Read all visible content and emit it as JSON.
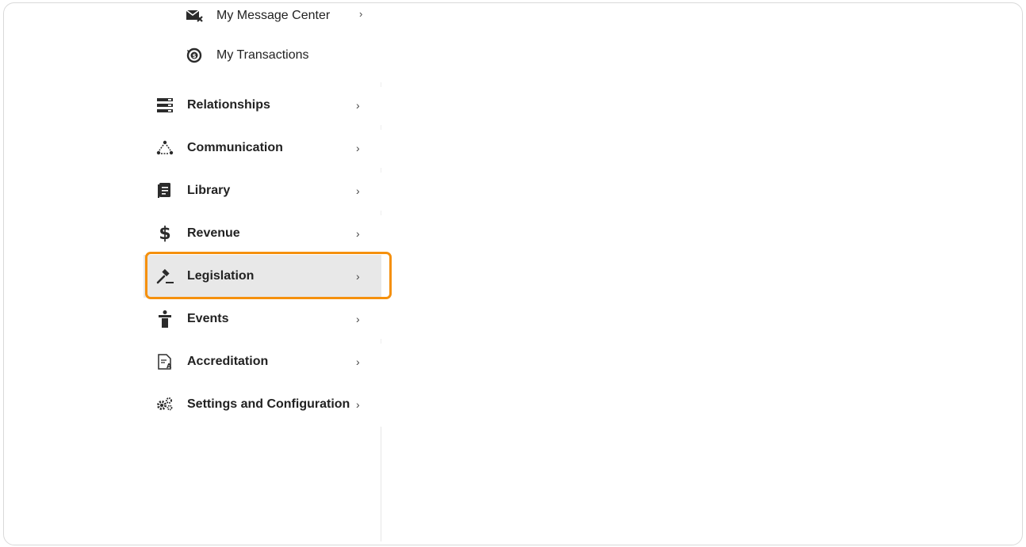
{
  "sidebar": {
    "sub_items": [
      {
        "label": "My Message Center",
        "icon": "mail-icon"
      },
      {
        "label": "My Transactions",
        "icon": "transactions-icon"
      }
    ],
    "items": [
      {
        "label": "Relationships",
        "icon": "relationships-icon"
      },
      {
        "label": "Communication",
        "icon": "communication-icon"
      },
      {
        "label": "Library",
        "icon": "library-icon"
      },
      {
        "label": "Revenue",
        "icon": "dollar-icon",
        "glyph": "$"
      },
      {
        "label": "Legislation",
        "icon": "gavel-icon",
        "active": true
      },
      {
        "label": "Events",
        "icon": "events-icon"
      },
      {
        "label": "Accreditation",
        "icon": "accreditation-icon"
      },
      {
        "label": "Settings and Configuration",
        "icon": "gears-icon"
      }
    ],
    "chevron": "›"
  },
  "colors": {
    "highlight": "#f5900d",
    "active_bg": "#e8e8e8",
    "text": "#222222"
  }
}
